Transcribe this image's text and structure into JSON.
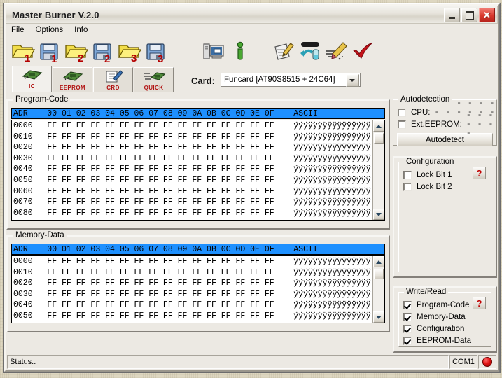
{
  "window": {
    "title": "Master Burner V.2.0",
    "buttons": {
      "minimize": "–",
      "maximize": "□",
      "close": "✕"
    }
  },
  "menu": {
    "items": [
      "File",
      "Options",
      "Info"
    ]
  },
  "toolbar": {
    "items": [
      {
        "name": "open-file-1",
        "icon": "folder-open-1-icon",
        "label": "1"
      },
      {
        "name": "save-file-1",
        "icon": "floppy-save-1-icon",
        "label": "1"
      },
      {
        "name": "open-file-2",
        "icon": "folder-open-2-icon",
        "label": "2"
      },
      {
        "name": "save-file-2",
        "icon": "floppy-save-2-icon",
        "label": "2"
      },
      {
        "name": "open-file-3",
        "icon": "folder-open-3-icon",
        "label": "3"
      },
      {
        "name": "save-file-3",
        "icon": "floppy-save-3-icon",
        "label": "3"
      },
      {
        "name": "hardware-settings",
        "icon": "computer-monitor-icon",
        "label": ""
      },
      {
        "name": "info-about",
        "icon": "information-icon",
        "label": ""
      },
      {
        "name": "write-card",
        "icon": "write-pencil-icon",
        "label": ""
      },
      {
        "name": "read-card",
        "icon": "read-testtube-icon",
        "label": ""
      },
      {
        "name": "erase-card",
        "icon": "eraser-brush-icon",
        "label": ""
      },
      {
        "name": "verify-card",
        "icon": "check-mark-icon",
        "label": ""
      }
    ]
  },
  "tabs": [
    {
      "label": "IC",
      "icon": "chip-icon",
      "selected": true
    },
    {
      "label": "EEPROM",
      "icon": "chip-icon",
      "selected": false
    },
    {
      "label": "CRD",
      "icon": "document-pencil-icon",
      "selected": false
    },
    {
      "label": "QUICK",
      "icon": "chip-fast-icon",
      "selected": false
    }
  ],
  "card": {
    "label": "Card:",
    "selected": "Funcard [AT90S8515 + 24C64]",
    "options": [
      "Funcard [AT90S8515 + 24C64]"
    ]
  },
  "program_code": {
    "caption": "Program-Code",
    "header": "ADR    00 01 02 03 04 05 06 07 08 09 0A 0B 0C 0D 0E 0F    ASCII",
    "rows": [
      {
        "addr": "0000",
        "bytes": "FF FF FF FF FF FF FF FF FF FF FF FF FF FF FF FF",
        "ascii": "ÿÿÿÿÿÿÿÿÿÿÿÿÿÿÿÿ"
      },
      {
        "addr": "0010",
        "bytes": "FF FF FF FF FF FF FF FF FF FF FF FF FF FF FF FF",
        "ascii": "ÿÿÿÿÿÿÿÿÿÿÿÿÿÿÿÿ"
      },
      {
        "addr": "0020",
        "bytes": "FF FF FF FF FF FF FF FF FF FF FF FF FF FF FF FF",
        "ascii": "ÿÿÿÿÿÿÿÿÿÿÿÿÿÿÿÿ"
      },
      {
        "addr": "0030",
        "bytes": "FF FF FF FF FF FF FF FF FF FF FF FF FF FF FF FF",
        "ascii": "ÿÿÿÿÿÿÿÿÿÿÿÿÿÿÿÿ"
      },
      {
        "addr": "0040",
        "bytes": "FF FF FF FF FF FF FF FF FF FF FF FF FF FF FF FF",
        "ascii": "ÿÿÿÿÿÿÿÿÿÿÿÿÿÿÿÿ"
      },
      {
        "addr": "0050",
        "bytes": "FF FF FF FF FF FF FF FF FF FF FF FF FF FF FF FF",
        "ascii": "ÿÿÿÿÿÿÿÿÿÿÿÿÿÿÿÿ"
      },
      {
        "addr": "0060",
        "bytes": "FF FF FF FF FF FF FF FF FF FF FF FF FF FF FF FF",
        "ascii": "ÿÿÿÿÿÿÿÿÿÿÿÿÿÿÿÿ"
      },
      {
        "addr": "0070",
        "bytes": "FF FF FF FF FF FF FF FF FF FF FF FF FF FF FF FF",
        "ascii": "ÿÿÿÿÿÿÿÿÿÿÿÿÿÿÿÿ"
      },
      {
        "addr": "0080",
        "bytes": "FF FF FF FF FF FF FF FF FF FF FF FF FF FF FF FF",
        "ascii": "ÿÿÿÿÿÿÿÿÿÿÿÿÿÿÿÿ"
      }
    ]
  },
  "memory_data": {
    "caption": "Memory-Data",
    "header": "ADR    00 01 02 03 04 05 06 07 08 09 0A 0B 0C 0D 0E 0F    ASCII",
    "rows": [
      {
        "addr": "0000",
        "bytes": "FF FF FF FF FF FF FF FF FF FF FF FF FF FF FF FF",
        "ascii": "ÿÿÿÿÿÿÿÿÿÿÿÿÿÿÿÿ"
      },
      {
        "addr": "0010",
        "bytes": "FF FF FF FF FF FF FF FF FF FF FF FF FF FF FF FF",
        "ascii": "ÿÿÿÿÿÿÿÿÿÿÿÿÿÿÿÿ"
      },
      {
        "addr": "0020",
        "bytes": "FF FF FF FF FF FF FF FF FF FF FF FF FF FF FF FF",
        "ascii": "ÿÿÿÿÿÿÿÿÿÿÿÿÿÿÿÿ"
      },
      {
        "addr": "0030",
        "bytes": "FF FF FF FF FF FF FF FF FF FF FF FF FF FF FF FF",
        "ascii": "ÿÿÿÿÿÿÿÿÿÿÿÿÿÿÿÿ"
      },
      {
        "addr": "0040",
        "bytes": "FF FF FF FF FF FF FF FF FF FF FF FF FF FF FF FF",
        "ascii": "ÿÿÿÿÿÿÿÿÿÿÿÿÿÿÿÿ"
      },
      {
        "addr": "0050",
        "bytes": "FF FF FF FF FF FF FF FF FF FF FF FF FF FF FF FF",
        "ascii": "ÿÿÿÿÿÿÿÿÿÿÿÿÿÿÿÿ"
      }
    ]
  },
  "autodetection": {
    "caption": "Autodetection",
    "cpu_label": "CPU:",
    "cpu_value": "- - - - - - - - - - - - -",
    "cpu_checked": false,
    "eeprom_label": "Ext.EEPROM:",
    "eeprom_value": "- - - - - - -",
    "eeprom_checked": false,
    "button": "Autodetect"
  },
  "configuration": {
    "caption": "Configuration",
    "help": "?",
    "items": [
      {
        "label": "Lock Bit 1",
        "checked": false
      },
      {
        "label": "Lock Bit 2",
        "checked": false
      }
    ]
  },
  "write_read": {
    "caption": "Write/Read",
    "help": "?",
    "items": [
      {
        "label": "Program-Code",
        "checked": true
      },
      {
        "label": "Memory-Data",
        "checked": true
      },
      {
        "label": "Configuration",
        "checked": true
      },
      {
        "label": "EEPROM-Data",
        "checked": true
      }
    ]
  },
  "status": {
    "text": "Status..",
    "port": "COM1",
    "led_color": "#e11414"
  }
}
